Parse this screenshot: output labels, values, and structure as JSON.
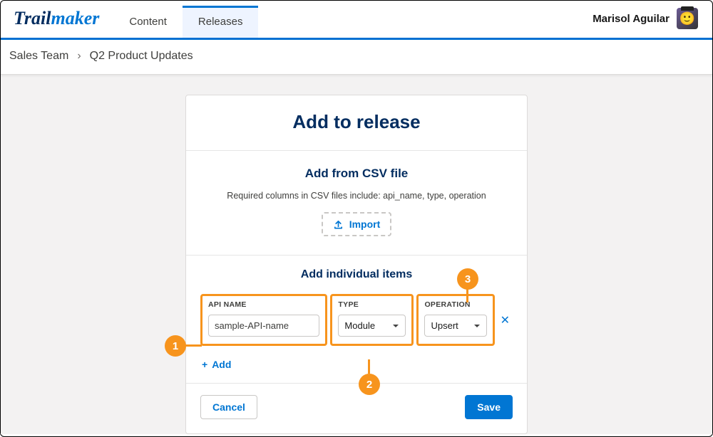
{
  "header": {
    "logo_trail": "Trail",
    "logo_maker": "maker",
    "tabs": {
      "content": "Content",
      "releases": "Releases"
    },
    "username": "Marisol Aguilar"
  },
  "breadcrumb": {
    "level1": "Sales Team",
    "level2": "Q2 Product Updates"
  },
  "card": {
    "title": "Add to release",
    "csv": {
      "heading": "Add from CSV file",
      "description": "Required columns in CSV files include: api_name, type, operation",
      "import_label": "Import"
    },
    "individual": {
      "heading": "Add individual items",
      "api_label": "API NAME",
      "api_value": "sample-API-name",
      "type_label": "TYPE",
      "type_value": "Module",
      "operation_label": "OPERATION",
      "operation_value": "Upsert",
      "add_label": "Add"
    },
    "footer": {
      "cancel_label": "Cancel",
      "save_label": "Save"
    }
  },
  "badges": {
    "b1": "1",
    "b2": "2",
    "b3": "3"
  }
}
